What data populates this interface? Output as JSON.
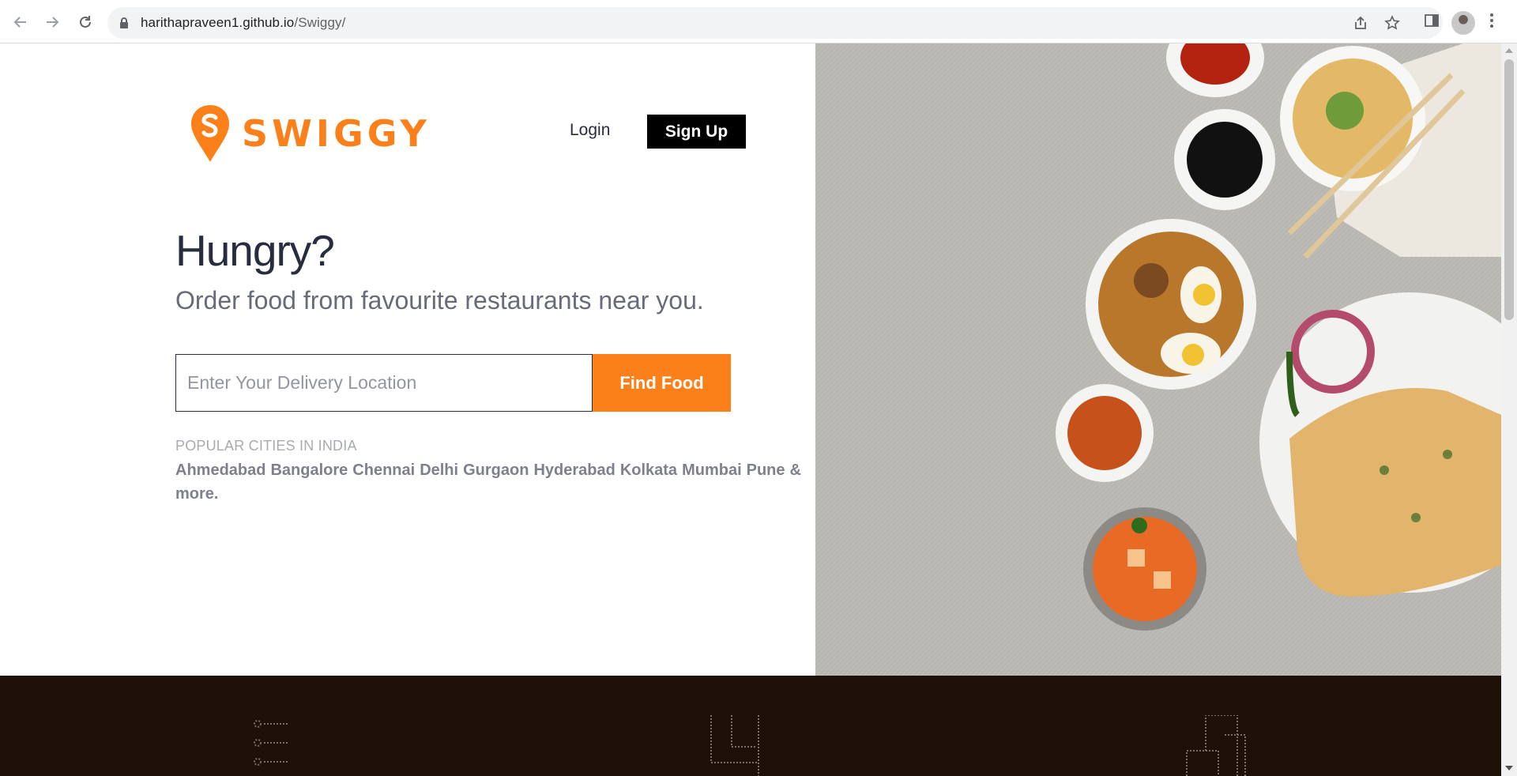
{
  "browser": {
    "url_host": "harithapraveen1.github.io",
    "url_path": "/Swiggy/"
  },
  "header": {
    "logo_text": "SWIGGY",
    "login_label": "Login",
    "signup_label": "Sign Up"
  },
  "hero": {
    "title": "Hungry?",
    "subtitle": "Order food from favourite restaurants near you.",
    "search_placeholder": "Enter Your Delivery Location",
    "find_button": "Find Food"
  },
  "cities": {
    "heading": "POPULAR CITIES IN INDIA",
    "items": [
      "Ahmedabad",
      "Bangalore",
      "Chennai",
      "Delhi",
      "Gurgaon",
      "Hyderabad",
      "Kolkata",
      "Mumbai",
      "Pune"
    ],
    "more": "& more."
  },
  "colors": {
    "brand": "#fc8019",
    "footer_bg": "#1d110a"
  }
}
